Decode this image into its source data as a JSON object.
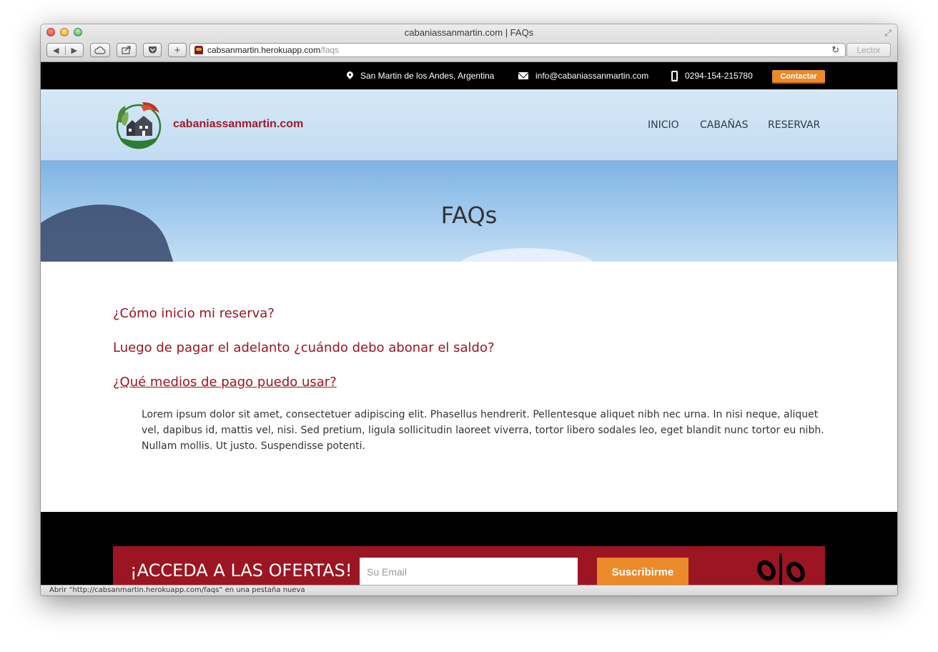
{
  "window": {
    "title": "cabaniassanmartin.com | FAQs"
  },
  "toolbar": {
    "back_glyph": "◀",
    "forward_glyph": "▶",
    "new_tab_glyph": "+",
    "reload_glyph": "↻",
    "reader_label": "Lector",
    "icons": [
      "back-icon",
      "forward-icon",
      "icloud-icon",
      "share-icon",
      "pocket-icon",
      "plus-icon",
      "reload-icon",
      "fullscreen-icon"
    ]
  },
  "urlbar": {
    "host": "cabsanmartin.herokuapp.com",
    "path": "/faqs"
  },
  "topbar": {
    "location": "San Martin de los Andes, Argentina",
    "email": "info@cabaniassanmartin.com",
    "phone": "0294-154-215780",
    "contact_label": "Contactar"
  },
  "header": {
    "logo_text": "cabaniassanmartin.com",
    "nav": [
      "INICIO",
      "CABAÑAS",
      "RESERVAR"
    ]
  },
  "hero": {
    "title": "FAQs"
  },
  "faqs": {
    "items": [
      "¿Cómo inicio mi reserva?",
      "Luego de pagar el adelanto ¿cuándo debo abonar el saldo?",
      "¿Qué medios de pago puedo usar?"
    ],
    "expanded_answer": "Lorem ipsum dolor sit amet, consectetuer adipiscing elit. Phasellus hendrerit. Pellentesque aliquet nibh nec urna. In nisi neque, aliquet vel, dapibus id, mattis vel, nisi. Sed pretium, ligula sollicitudin laoreet viverra, tortor libero sodales leo, eget blandit nunc tortor eu nibh. Nullam mollis. Ut justo. Suspendisse potenti."
  },
  "footer": {
    "offer_title": "¡ACCEDA A LAS OFERTAS!",
    "email_placeholder": "Su Email",
    "subscribe_label": "Suscribirme"
  },
  "statusbar": {
    "text": "Abrir “http://cabsanmartin.herokuapp.com/faqs” en una pestaña nueva"
  },
  "colors": {
    "brand_red": "#9b1423",
    "accent_orange": "#ea8a2b",
    "topbar_black": "#000000",
    "header_blue": "#cfe3f5"
  }
}
